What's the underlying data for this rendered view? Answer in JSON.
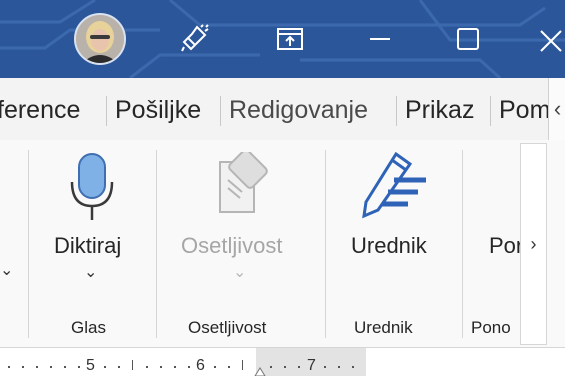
{
  "titlebar": {
    "background": "#2b579a",
    "avatar_alt": "User profile photo",
    "buttons": [
      "lightbulb-icon",
      "ribbon-display-options-icon",
      "minimize-icon",
      "restore-icon",
      "close-icon"
    ]
  },
  "tabs": [
    {
      "label": "ference"
    },
    {
      "label": "Pošiljke"
    },
    {
      "label": "Redigovanje"
    },
    {
      "label": "Prikaz"
    },
    {
      "label": "Pom"
    }
  ],
  "ribbon": {
    "buttons": {
      "dictate": {
        "label": "Diktiraj",
        "icon": "microphone-icon",
        "enabled": true
      },
      "sensitivity": {
        "label": "Osetljivost",
        "icon": "sensitivity-icon",
        "enabled": false
      },
      "editor": {
        "label": "Urednik",
        "icon": "editor-pen-icon",
        "enabled": true
      },
      "partial": {
        "label": "Por"
      }
    },
    "groups": {
      "voice": "Glas",
      "sensitivity": "Osetljivost",
      "editor": "Urednik",
      "partial": "Pono"
    }
  },
  "ruler": {
    "numbers": [
      "5",
      "6",
      "7"
    ]
  },
  "colors": {
    "accent": "#2b579a",
    "mic": "#7fb1e6",
    "pen": "#2e63b8"
  }
}
